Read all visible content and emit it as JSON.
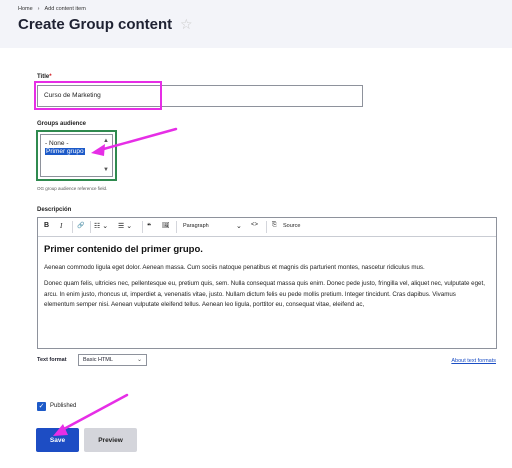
{
  "breadcrumb": {
    "home": "Home",
    "sep": "›",
    "current": "Add content item"
  },
  "page": {
    "title": "Create Group content",
    "star": "☆"
  },
  "title_field": {
    "label": "Title",
    "required_mark": "*",
    "value": "Curso de Marketing"
  },
  "audience": {
    "label": "Groups audience",
    "options": [
      "- None -",
      "Primer grupo"
    ],
    "selected": "Primer grupo",
    "help": "OG group audience reference field."
  },
  "description": {
    "label": "Descripción",
    "toolbar": {
      "bold": "B",
      "italic": "I",
      "link": "🔗",
      "bullet_list": "☷ ⌄",
      "numbered_list": "☰ ⌄",
      "blockquote": "❝",
      "image": "🖼",
      "heading": "Paragraph",
      "heading_chev": "⌄",
      "code": "<>",
      "source": "Source"
    },
    "heading": "Primer contenido del primer grupo.",
    "paragraphs": [
      "Aenean commodo ligula eget dolor. Aenean massa. Cum sociis natoque penatibus et magnis dis parturient montes, nascetur ridiculus mus.",
      "Donec quam felis, ultricies nec, pellentesque eu, pretium quis, sem. Nulla consequat massa quis enim. Donec pede justo, fringilla vel, aliquet nec, vulputate eget, arcu. In enim justo, rhoncus ut, imperdiet a, venenatis vitae, justo. Nullam dictum felis eu pede mollis pretium. Integer tincidunt. Cras dapibus. Vivamus elementum semper nisi. Aenean vulputate eleifend tellus. Aenean leo ligula, porttitor eu, consequat vitae, eleifend ac,"
    ]
  },
  "text_format": {
    "label": "Text format",
    "value": "Basic HTML",
    "about": "About text formats"
  },
  "published": {
    "label": "Published",
    "checked": true
  },
  "buttons": {
    "save": "Save",
    "preview": "Preview"
  },
  "colors": {
    "annotation": "#e62ee6",
    "focus_outline": "#2f8a4f",
    "primary": "#1d4dc4"
  }
}
